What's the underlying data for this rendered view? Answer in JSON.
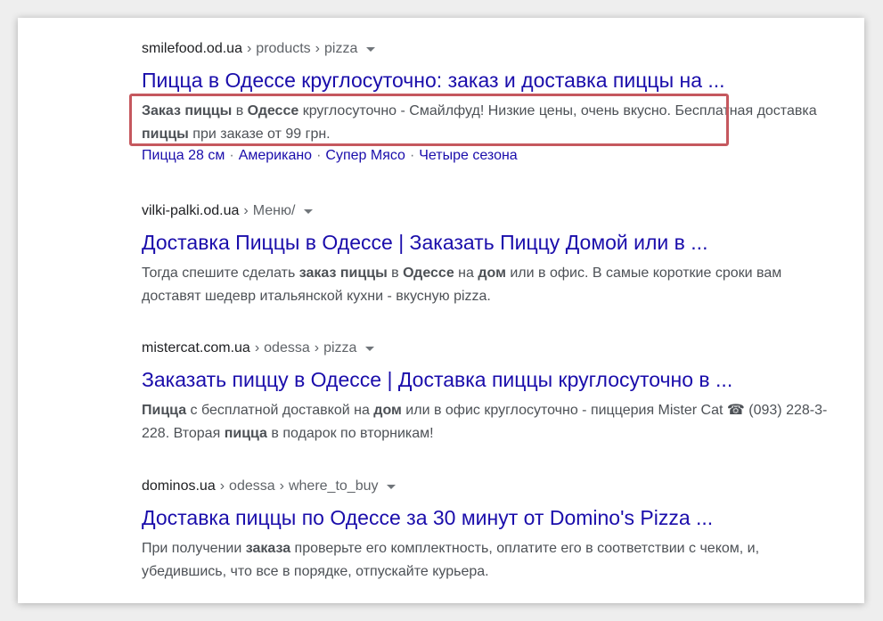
{
  "results": [
    {
      "domain": "smilefood.od.ua",
      "path": [
        "products",
        "pizza"
      ],
      "title": "Пицца в Одессе круглосуточно: заказ и доставка пиццы на ...",
      "snippet": [
        {
          "t": "Заказ пиццы",
          "b": true
        },
        {
          "t": " в ",
          "b": false
        },
        {
          "t": "Одессе",
          "b": true
        },
        {
          "t": " круглосуточно - Смайлфуд! Низкие цены, очень вкусно. Бесплатная доставка ",
          "b": false
        },
        {
          "t": "пиццы",
          "b": true
        },
        {
          "t": " при заказе от 99 грн.",
          "b": false
        }
      ],
      "sitelinks": [
        "Пицца 28 см",
        "Американо",
        "Супер Мясо",
        "Четыре сезона"
      ]
    },
    {
      "domain": "vilki-palki.od.ua",
      "path": [
        "Меню/"
      ],
      "title": "Доставка Пиццы в Одессе | Заказать Пиццу Домой или в ...",
      "snippet": [
        {
          "t": "Тогда спешите сделать ",
          "b": false
        },
        {
          "t": "заказ пиццы",
          "b": true
        },
        {
          "t": " в ",
          "b": false
        },
        {
          "t": "Одессе",
          "b": true
        },
        {
          "t": " на ",
          "b": false
        },
        {
          "t": "дом",
          "b": true
        },
        {
          "t": " или в офис. В самые короткие сроки вам доставят шедевр итальянской кухни - вкусную pizza.",
          "b": false
        }
      ]
    },
    {
      "domain": "mistercat.com.ua",
      "path": [
        "odessa",
        "pizza"
      ],
      "title": "Заказать пиццу в Одессе | Доставка пиццы круглосуточно в ...",
      "snippet": [
        {
          "t": "Пицца",
          "b": true
        },
        {
          "t": " с бесплатной доставкой на ",
          "b": false
        },
        {
          "t": "дом",
          "b": true
        },
        {
          "t": " или в офис круглосуточно - пиццерия Mister Cat ☎ (093) 228-3-228. Вторая ",
          "b": false
        },
        {
          "t": "пицца",
          "b": true
        },
        {
          "t": " в подарок по вторникам!",
          "b": false
        }
      ]
    },
    {
      "domain": "dominos.ua",
      "path": [
        "odessa",
        "where_to_buy"
      ],
      "title": "Доставка пиццы по Одессе за 30 минут от Domino's Pizza ...",
      "snippet": [
        {
          "t": "При получении ",
          "b": false
        },
        {
          "t": "заказа",
          "b": true
        },
        {
          "t": " проверьте его комплектность, оплатите его в соответствии с чеком, и, убедившись, что все в порядке, отпускайте курьера.",
          "b": false
        }
      ]
    }
  ],
  "separator": "›",
  "sitelink_separator": "·",
  "colors": {
    "title_link": "#1a0dab",
    "snippet_text": "#4d5156",
    "highlight_border": "#c5585e"
  }
}
